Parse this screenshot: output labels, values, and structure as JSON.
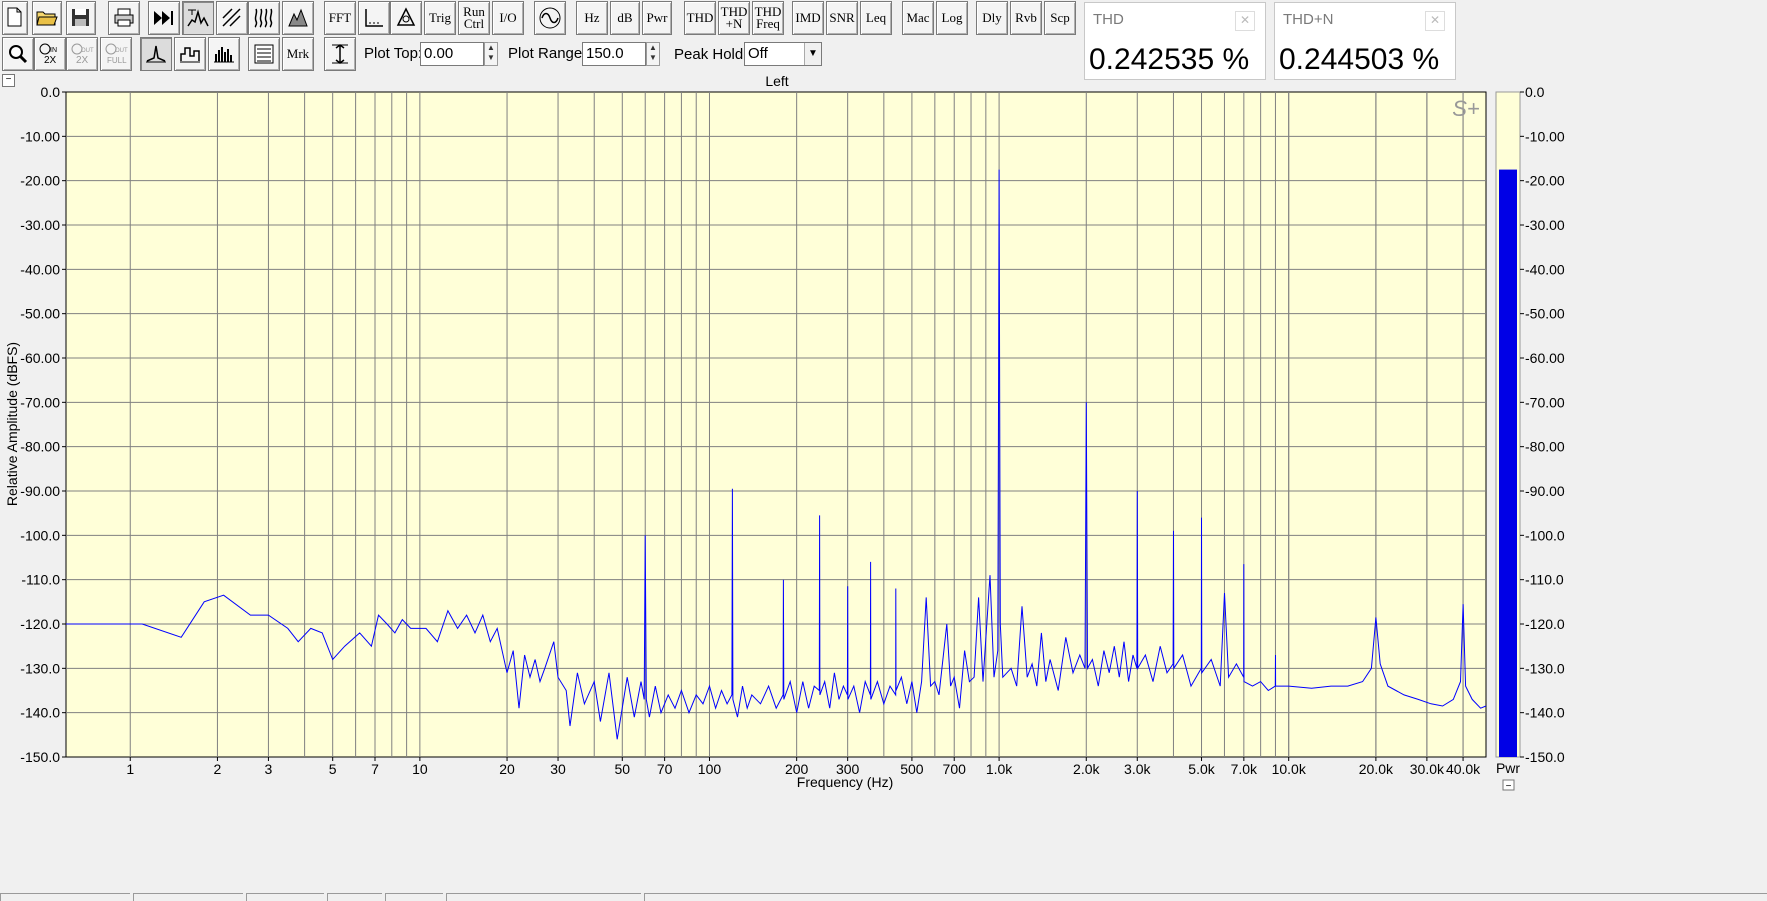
{
  "toolbar": {
    "row1": [
      {
        "name": "new-file-button",
        "icon": "new-file-icon",
        "label": ""
      },
      {
        "name": "open-file-button",
        "icon": "open-folder-icon",
        "label": ""
      },
      {
        "name": "save-button",
        "icon": "save-disk-icon",
        "label": ""
      },
      {
        "name": "print-button",
        "icon": "printer-icon",
        "label": ""
      },
      {
        "name": "fast-forward-button",
        "icon": "fast-forward-icon",
        "label": ""
      },
      {
        "name": "spectrum-view-button",
        "icon": "spectrum-icon",
        "label": ""
      },
      {
        "name": "time-series-button",
        "icon": "waveform-icon",
        "label": ""
      },
      {
        "name": "spectrogram-button",
        "icon": "spectrogram-icon",
        "label": ""
      },
      {
        "name": "3d-surface-button",
        "icon": "3d-plot-icon",
        "label": ""
      },
      {
        "name": "fft-button",
        "label": "FFT"
      },
      {
        "name": "averaging-button",
        "icon": "averaging-icon",
        "label": ""
      },
      {
        "name": "calibration-button",
        "icon": "calibration-icon",
        "label": ""
      },
      {
        "name": "trigger-button",
        "label": "Trig"
      },
      {
        "name": "run-control-button",
        "label": "Run Ctrl"
      },
      {
        "name": "io-button",
        "label": "I/O"
      },
      {
        "name": "signal-generator-button",
        "icon": "sine-wave-icon",
        "label": ""
      },
      {
        "name": "hz-button",
        "label": "Hz"
      },
      {
        "name": "db-button",
        "label": "dB"
      },
      {
        "name": "pwr-button",
        "label": "Pwr"
      },
      {
        "name": "thd-button",
        "label": "THD"
      },
      {
        "name": "thd-n-button",
        "label": "THD +N"
      },
      {
        "name": "thd-freq-button",
        "label": "THD Freq"
      },
      {
        "name": "imd-button",
        "label": "IMD"
      },
      {
        "name": "snr-button",
        "label": "SNR"
      },
      {
        "name": "leq-button",
        "label": "Leq"
      },
      {
        "name": "macro-button",
        "label": "Mac"
      },
      {
        "name": "log-button",
        "label": "Log"
      },
      {
        "name": "delay-button",
        "label": "Dly"
      },
      {
        "name": "reverb-button",
        "label": "Rvb"
      },
      {
        "name": "scope-button",
        "label": "Scp"
      }
    ],
    "row2": [
      {
        "name": "zoom-button",
        "icon": "magnifier-icon",
        "label": ""
      },
      {
        "name": "zoom-in-2x-button",
        "icon": "zoom-in-2x-icon",
        "label": ""
      },
      {
        "name": "zoom-out-2x-button",
        "icon": "zoom-out-2x-icon",
        "label": ""
      },
      {
        "name": "zoom-out-full-button",
        "icon": "zoom-out-full-icon",
        "label": ""
      },
      {
        "name": "line-plot-button",
        "icon": "line-plot-icon",
        "label": ""
      },
      {
        "name": "step-plot-button",
        "icon": "step-plot-icon",
        "label": ""
      },
      {
        "name": "bar-plot-button",
        "icon": "bar-plot-icon",
        "label": ""
      },
      {
        "name": "overlay-button",
        "icon": "overlay-icon",
        "label": ""
      },
      {
        "name": "marker-button",
        "label": "Mrk"
      },
      {
        "name": "y-scale-button",
        "icon": "y-scale-icon",
        "label": ""
      }
    ],
    "plot_top_label": "Plot Top:",
    "plot_top_value": "0.00",
    "plot_range_label": "Plot Range:",
    "plot_range_value": "150.0",
    "peak_hold_label": "Peak Hold:",
    "peak_hold_value": "Off"
  },
  "meters": {
    "thd": {
      "title": "THD",
      "value": "0.242535 %"
    },
    "thd_n": {
      "title": "THD+N",
      "value": "0.244503 %"
    }
  },
  "chart_data": {
    "type": "line",
    "title": "Left",
    "xlabel": "Frequency (Hz)",
    "ylabel": "Relative Amplitude (dBFS)",
    "x_scale": "log",
    "xlim": [
      0.6,
      48000
    ],
    "ylim": [
      -150,
      0
    ],
    "grid": true,
    "background": "#ffffd8",
    "line_color": "#0000ff",
    "ytick_labels": [
      "0.0",
      "-10.00",
      "-20.00",
      "-30.00",
      "-40.00",
      "-50.00",
      "-60.00",
      "-70.00",
      "-80.00",
      "-90.00",
      "-100.0",
      "-110.0",
      "-120.0",
      "-130.0",
      "-140.0",
      "-150.0"
    ],
    "xticks": [
      {
        "value": 1,
        "label": "1"
      },
      {
        "value": 2,
        "label": "2"
      },
      {
        "value": 3,
        "label": "3"
      },
      {
        "value": 5,
        "label": "5"
      },
      {
        "value": 7,
        "label": "7"
      },
      {
        "value": 10,
        "label": "10"
      },
      {
        "value": 20,
        "label": "20"
      },
      {
        "value": 30,
        "label": "30"
      },
      {
        "value": 50,
        "label": "50"
      },
      {
        "value": 70,
        "label": "70"
      },
      {
        "value": 100,
        "label": "100"
      },
      {
        "value": 200,
        "label": "200"
      },
      {
        "value": 300,
        "label": "300"
      },
      {
        "value": 500,
        "label": "500"
      },
      {
        "value": 700,
        "label": "700"
      },
      {
        "value": 1000,
        "label": "1.0k"
      },
      {
        "value": 2000,
        "label": "2.0k"
      },
      {
        "value": 3000,
        "label": "3.0k"
      },
      {
        "value": 5000,
        "label": "5.0k"
      },
      {
        "value": 7000,
        "label": "7.0k"
      },
      {
        "value": 10000,
        "label": "10.0k"
      },
      {
        "value": 20000,
        "label": "20.0k"
      },
      {
        "value": 30000,
        "label": "30.0k"
      },
      {
        "value": 40000,
        "label": "40.0k"
      }
    ],
    "series": [
      {
        "values": [
          [
            0.6,
            -120
          ],
          [
            0.9,
            -120
          ],
          [
            1.1,
            -120
          ],
          [
            1.5,
            -123
          ],
          [
            1.8,
            -115
          ],
          [
            2.1,
            -113.5
          ],
          [
            2.6,
            -118
          ],
          [
            3.0,
            -118
          ],
          [
            3.5,
            -121
          ],
          [
            3.8,
            -124
          ],
          [
            4.2,
            -121
          ],
          [
            4.6,
            -122
          ],
          [
            5.0,
            -128
          ],
          [
            5.5,
            -125
          ],
          [
            6.2,
            -122
          ],
          [
            6.8,
            -125
          ],
          [
            7.2,
            -118
          ],
          [
            7.7,
            -120
          ],
          [
            8.2,
            -122
          ],
          [
            8.7,
            -119
          ],
          [
            9.3,
            -121
          ],
          [
            10.5,
            -121
          ],
          [
            11.5,
            -124
          ],
          [
            12.5,
            -117
          ],
          [
            13.5,
            -121
          ],
          [
            14.5,
            -118
          ],
          [
            15.5,
            -122
          ],
          [
            16.5,
            -118
          ],
          [
            17.5,
            -124
          ],
          [
            18.5,
            -121
          ],
          [
            20,
            -131
          ],
          [
            21,
            -126
          ],
          [
            22,
            -139
          ],
          [
            23,
            -127
          ],
          [
            24,
            -132
          ],
          [
            25,
            -128
          ],
          [
            26,
            -133
          ],
          [
            27,
            -130
          ],
          [
            29,
            -124
          ],
          [
            30,
            -132
          ],
          [
            32,
            -135
          ],
          [
            33,
            -143
          ],
          [
            35,
            -131
          ],
          [
            37,
            -138
          ],
          [
            40,
            -133
          ],
          [
            42,
            -142
          ],
          [
            45,
            -131
          ],
          [
            48,
            -146
          ],
          [
            52,
            -132
          ],
          [
            55,
            -141
          ],
          [
            58,
            -133
          ],
          [
            59.5,
            -137
          ],
          [
            60,
            -100
          ],
          [
            60.5,
            -137
          ],
          [
            62,
            -141
          ],
          [
            65,
            -134
          ],
          [
            68,
            -140
          ],
          [
            72,
            -136
          ],
          [
            76,
            -139
          ],
          [
            80,
            -135
          ],
          [
            85,
            -140
          ],
          [
            90,
            -136
          ],
          [
            95,
            -138
          ],
          [
            100,
            -134
          ],
          [
            105,
            -139
          ],
          [
            110,
            -135
          ],
          [
            115,
            -138
          ],
          [
            119.5,
            -136
          ],
          [
            120,
            -89.5
          ],
          [
            120.5,
            -137
          ],
          [
            125,
            -141
          ],
          [
            130,
            -134
          ],
          [
            135,
            -139
          ],
          [
            140,
            -136
          ],
          [
            150,
            -138
          ],
          [
            160,
            -134
          ],
          [
            170,
            -139
          ],
          [
            179.5,
            -136
          ],
          [
            180,
            -110
          ],
          [
            180.5,
            -137
          ],
          [
            190,
            -133
          ],
          [
            200,
            -140
          ],
          [
            210,
            -133
          ],
          [
            220,
            -139
          ],
          [
            230,
            -134
          ],
          [
            239.5,
            -135
          ],
          [
            240,
            -95.5
          ],
          [
            240.5,
            -136
          ],
          [
            250,
            -133
          ],
          [
            260,
            -139
          ],
          [
            270,
            -131
          ],
          [
            280,
            -137
          ],
          [
            290,
            -134
          ],
          [
            299.5,
            -136
          ],
          [
            300,
            -111.5
          ],
          [
            300.5,
            -137
          ],
          [
            315,
            -134
          ],
          [
            330,
            -140
          ],
          [
            345,
            -133
          ],
          [
            359.5,
            -136
          ],
          [
            360,
            -106
          ],
          [
            360.5,
            -137
          ],
          [
            380,
            -133
          ],
          [
            400,
            -138
          ],
          [
            420,
            -134
          ],
          [
            439.5,
            -136
          ],
          [
            440,
            -112
          ],
          [
            440.5,
            -135
          ],
          [
            460,
            -132
          ],
          [
            480,
            -138
          ],
          [
            500,
            -133
          ],
          [
            520,
            -140
          ],
          [
            540,
            -133
          ],
          [
            560,
            -114
          ],
          [
            580,
            -134
          ],
          [
            600,
            -133
          ],
          [
            620,
            -136
          ],
          [
            660,
            -120
          ],
          [
            680,
            -134
          ],
          [
            700,
            -132
          ],
          [
            730,
            -139
          ],
          [
            760,
            -126
          ],
          [
            790,
            -133
          ],
          [
            820,
            -132
          ],
          [
            850,
            -114
          ],
          [
            880,
            -133
          ],
          [
            930,
            -109
          ],
          [
            960,
            -132
          ],
          [
            990,
            -126
          ],
          [
            996,
            -63
          ],
          [
            1000,
            -17.5
          ],
          [
            1004,
            -62
          ],
          [
            1010,
            -120
          ],
          [
            1030,
            -132
          ],
          [
            1100,
            -130
          ],
          [
            1150,
            -134
          ],
          [
            1200,
            -116
          ],
          [
            1250,
            -132
          ],
          [
            1300,
            -129
          ],
          [
            1350,
            -134
          ],
          [
            1400,
            -122
          ],
          [
            1450,
            -133
          ],
          [
            1500,
            -128
          ],
          [
            1600,
            -135
          ],
          [
            1700,
            -123
          ],
          [
            1800,
            -131
          ],
          [
            1900,
            -127
          ],
          [
            1980,
            -130
          ],
          [
            2000,
            -70
          ],
          [
            2020,
            -130
          ],
          [
            2100,
            -128
          ],
          [
            2200,
            -134
          ],
          [
            2300,
            -126
          ],
          [
            2400,
            -131
          ],
          [
            2500,
            -125
          ],
          [
            2600,
            -132
          ],
          [
            2700,
            -124
          ],
          [
            2800,
            -133
          ],
          [
            2900,
            -127
          ],
          [
            2990,
            -130
          ],
          [
            3000,
            -90
          ],
          [
            3010,
            -130
          ],
          [
            3200,
            -127
          ],
          [
            3400,
            -133
          ],
          [
            3600,
            -125
          ],
          [
            3800,
            -131
          ],
          [
            3990,
            -129
          ],
          [
            4000,
            -99
          ],
          [
            4010,
            -130
          ],
          [
            4300,
            -127
          ],
          [
            4600,
            -134
          ],
          [
            4990,
            -130
          ],
          [
            5000,
            -96
          ],
          [
            5010,
            -131
          ],
          [
            5400,
            -128
          ],
          [
            5800,
            -134
          ],
          [
            6000,
            -113
          ],
          [
            6200,
            -132
          ],
          [
            6600,
            -129
          ],
          [
            6990,
            -132
          ],
          [
            7000,
            -106.5
          ],
          [
            7010,
            -133
          ],
          [
            7500,
            -134
          ],
          [
            8000,
            -133
          ],
          [
            8500,
            -135
          ],
          [
            8990,
            -134
          ],
          [
            9000,
            -127
          ],
          [
            9010,
            -134
          ],
          [
            10000,
            -134
          ],
          [
            12000,
            -134.5
          ],
          [
            14000,
            -134
          ],
          [
            16000,
            -134
          ],
          [
            18000,
            -133
          ],
          [
            19300,
            -130
          ],
          [
            20000,
            -118.5
          ],
          [
            20700,
            -129
          ],
          [
            22000,
            -134
          ],
          [
            25000,
            -136
          ],
          [
            28000,
            -137
          ],
          [
            31000,
            -138
          ],
          [
            34000,
            -138.5
          ],
          [
            37000,
            -137
          ],
          [
            39200,
            -133
          ],
          [
            40000,
            -115.5
          ],
          [
            40800,
            -134
          ],
          [
            43000,
            -137
          ],
          [
            46000,
            -139
          ],
          [
            48000,
            -138.5
          ]
        ]
      }
    ]
  },
  "power_meter": {
    "label": "Pwr",
    "level_dbfs": -17.5,
    "ylim": [
      -150,
      0
    ],
    "bar_color": "#0000e6",
    "ytick_labels": [
      "0.0",
      "-10.00",
      "-20.00",
      "-30.00",
      "-40.00",
      "-50.00",
      "-60.00",
      "-70.00",
      "-80.00",
      "-90.00",
      "-100.0",
      "-110.0",
      "-120.0",
      "-130.0",
      "-140.0",
      "-150.0"
    ]
  }
}
